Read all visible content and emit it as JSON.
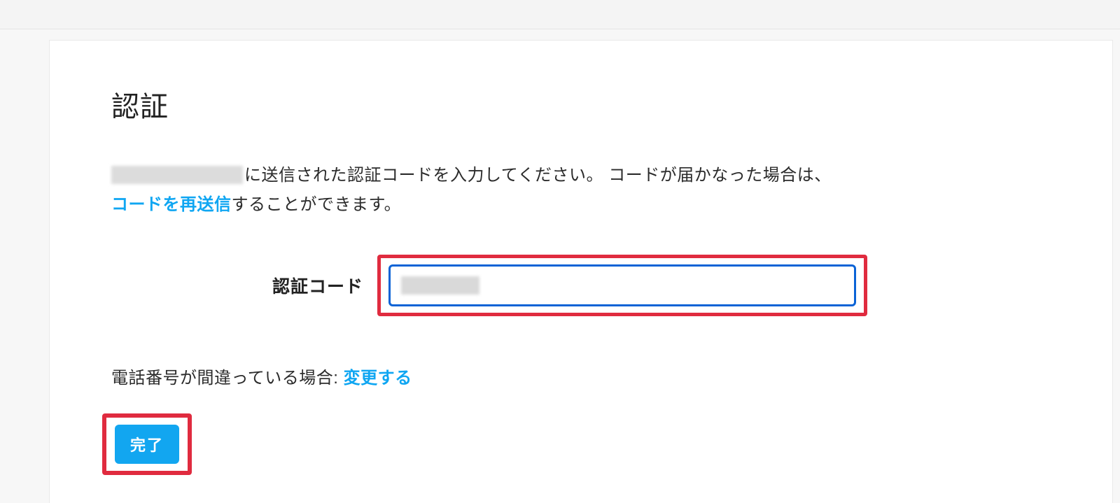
{
  "heading": "認証",
  "description": {
    "part1": "に送信された認証コードを入力してください。 コードが届かなった場合は、",
    "resend_link": "コードを再送信",
    "part2": "することができます。"
  },
  "form": {
    "code_label": "認証コード",
    "code_value": ""
  },
  "wrong_phone": {
    "prefix": "電話番号が間違っている場合: ",
    "change_link": "変更する"
  },
  "submit_label": "完了"
}
